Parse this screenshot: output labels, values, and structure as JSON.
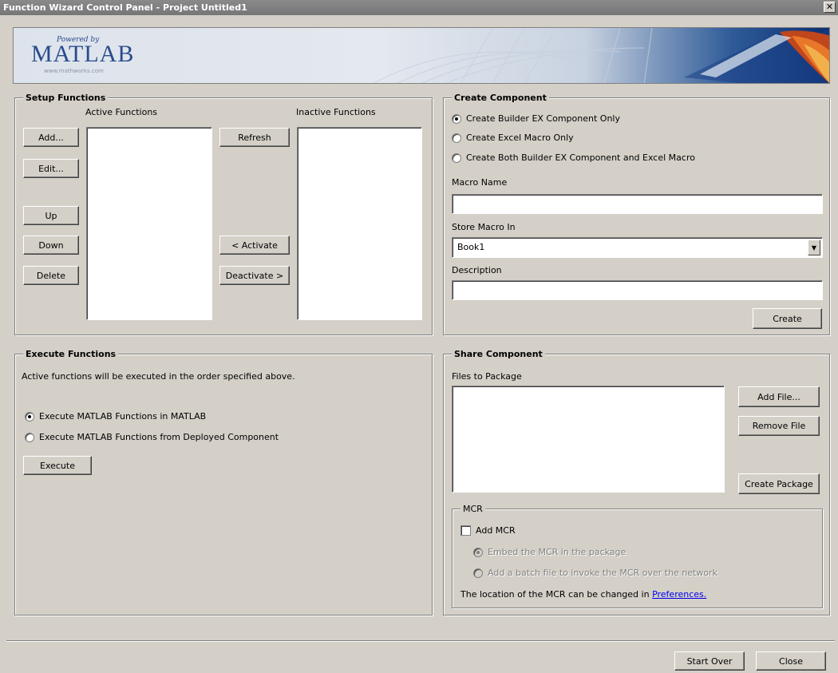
{
  "window": {
    "title": "Function Wizard Control Panel - Project Untitled1",
    "close_glyph": "✕"
  },
  "banner": {
    "powered_by": "Powered by",
    "wordmark": "MATLAB",
    "url": "www.mathworks.com"
  },
  "setup": {
    "title": "Setup Functions",
    "active_label": "Active Functions",
    "inactive_label": "Inactive Functions",
    "add": "Add...",
    "edit": "Edit...",
    "up": "Up",
    "down": "Down",
    "delete": "Delete",
    "refresh": "Refresh",
    "activate": "< Activate",
    "deactivate": "Deactivate >"
  },
  "create": {
    "title": "Create Component",
    "option1": "Create Builder EX Component Only",
    "option2": "Create Excel Macro Only",
    "option3": "Create Both Builder EX Component and Excel Macro",
    "macro_name_label": "Macro Name",
    "macro_name_value": "",
    "store_label": "Store Macro In",
    "store_value": "Book1",
    "description_label": "Description",
    "description_value": "",
    "create_button": "Create"
  },
  "execute": {
    "title": "Execute Functions",
    "note": "Active functions will be executed in the order specified above.",
    "option1": "Execute MATLAB Functions in MATLAB",
    "option2": "Execute MATLAB Functions from Deployed Component",
    "execute_button": "Execute"
  },
  "share": {
    "title": "Share Component",
    "files_label": "Files to Package",
    "add_file": "Add File...",
    "remove_file": "Remove File",
    "create_package": "Create Package",
    "mcr": {
      "title": "MCR",
      "add_mcr": "Add MCR",
      "embed": "Embed the MCR in the package",
      "batch": "Add a batch file to invoke the MCR over the network",
      "location_text": "The location of the MCR can be changed in",
      "preferences_link": "Preferences."
    }
  },
  "footer": {
    "start_over": "Start Over",
    "close": "Close"
  }
}
